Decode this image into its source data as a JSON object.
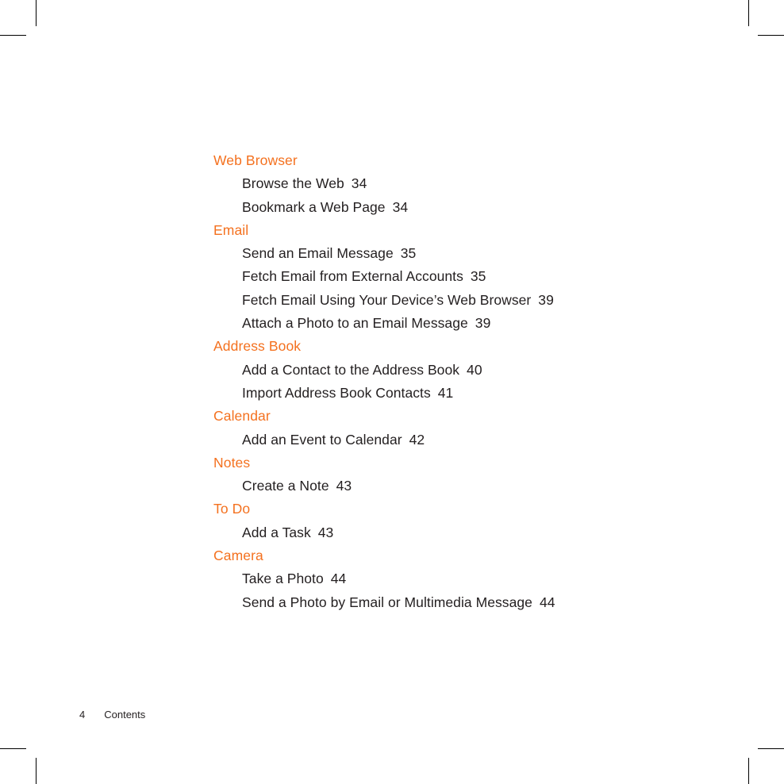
{
  "page": {
    "background_color": "#ffffff",
    "heading_color": "#f4711f",
    "text_color": "#231f20"
  },
  "toc": {
    "groups": [
      {
        "heading": "Web Browser",
        "entries": [
          {
            "title": "Browse the Web",
            "page": "34"
          },
          {
            "title": "Bookmark a Web Page",
            "page": "34"
          }
        ]
      },
      {
        "heading": "Email",
        "entries": [
          {
            "title": "Send an Email Message",
            "page": "35"
          },
          {
            "title": "Fetch Email from External Accounts",
            "page": "35"
          },
          {
            "title": "Fetch Email Using Your Device’s Web Browser",
            "page": "39"
          },
          {
            "title": "Attach a Photo to an Email Message",
            "page": "39"
          }
        ]
      },
      {
        "heading": "Address Book",
        "entries": [
          {
            "title": "Add a Contact to the Address Book",
            "page": "40"
          },
          {
            "title": "Import Address Book Contacts",
            "page": "41"
          }
        ]
      },
      {
        "heading": "Calendar",
        "entries": [
          {
            "title": "Add an Event to Calendar",
            "page": "42"
          }
        ]
      },
      {
        "heading": "Notes",
        "entries": [
          {
            "title": "Create a Note",
            "page": "43"
          }
        ]
      },
      {
        "heading": "To Do",
        "entries": [
          {
            "title": "Add a Task",
            "page": "43"
          }
        ]
      },
      {
        "heading": "Camera",
        "entries": [
          {
            "title": "Take a Photo",
            "page": "44"
          },
          {
            "title": "Send a Photo by Email or Multimedia Message",
            "page": "44"
          }
        ]
      }
    ]
  },
  "footer": {
    "folio": "4",
    "label": "Contents"
  }
}
